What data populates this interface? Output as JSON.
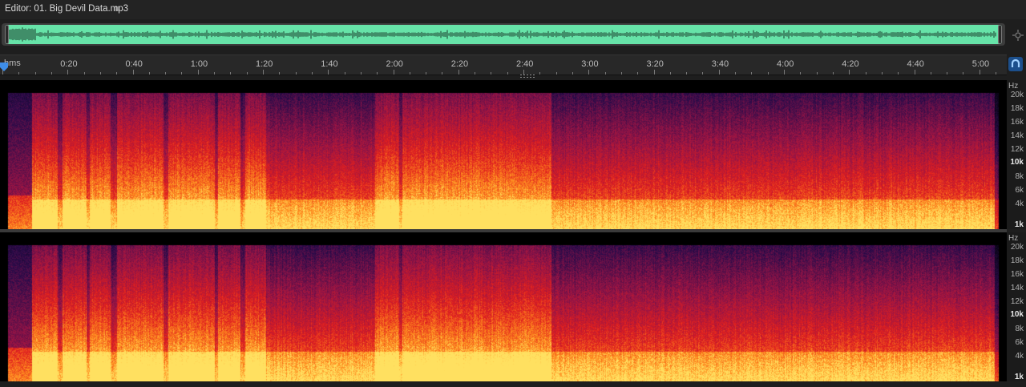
{
  "editor": {
    "title": "Editor: 01. Big Devil Data.mp3",
    "menu_icon": "hamburger-menu-icon"
  },
  "overview": {
    "colors": {
      "track": "#66e3a8",
      "wave": "#1a3a2a"
    }
  },
  "ruler": {
    "unit_label": "hms",
    "labels": [
      "0:20",
      "0:40",
      "1:00",
      "1:20",
      "1:40",
      "2:00",
      "2:20",
      "2:40",
      "3:00",
      "3:20",
      "3:40",
      "4:00",
      "4:20",
      "4:40",
      "5:00"
    ]
  },
  "frequency_scale": {
    "unit": "Hz",
    "labels": [
      "20k",
      "18k",
      "16k",
      "14k",
      "12k",
      "10k",
      "8k",
      "6k",
      "4k",
      "1k"
    ],
    "bold_labels": [
      "10k",
      "1k"
    ]
  },
  "spectrogram": {
    "colors": {
      "low": "#2a0b4a",
      "mid": "#e01f1f",
      "high": "#ffe060"
    },
    "channels": 2
  }
}
